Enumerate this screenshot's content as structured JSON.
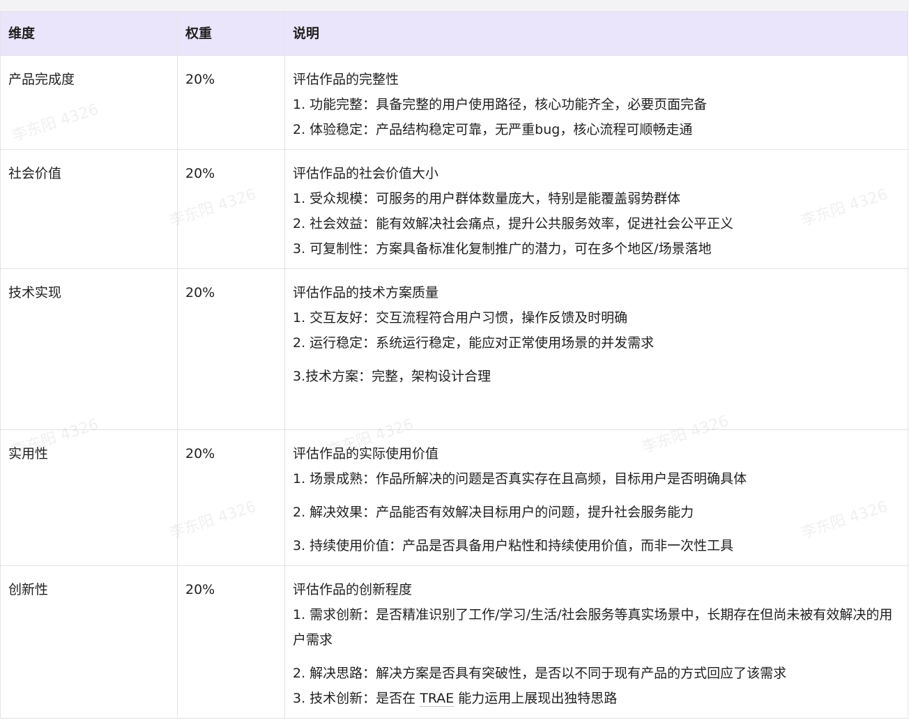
{
  "table": {
    "headers": [
      "维度",
      "权重",
      "说明"
    ],
    "rows": [
      {
        "dimension": "产品完成度",
        "weight": "20%",
        "lines": [
          "评估作品的完整性",
          "1. 功能完整：具备完整的用户使用路径，核心功能齐全，必要页面完备",
          "2. 体验稳定：产品结构稳定可靠，无严重bug，核心流程可顺畅走通"
        ]
      },
      {
        "dimension": "社会价值",
        "weight": "20%",
        "lines": [
          "评估作品的社会价值大小",
          "1. 受众规模：可服务的用户群体数量庞大，特别是能覆盖弱势群体",
          "2. 社会效益：能有效解决社会痛点，提升公共服务效率，促进社会公平正义",
          "3. 可复制性：方案具备标准化复制推广的潜力，可在多个地区/场景落地"
        ]
      },
      {
        "dimension": "技术实现",
        "weight": "20%",
        "lines": [
          "评估作品的技术方案质量",
          "1. 交互友好：交互流程符合用户习惯，操作反馈及时明确",
          "2. 运行稳定：系统运行稳定，能应对正常使用场景的并发需求",
          "3.技术方案：完整，架构设计合理"
        ]
      },
      {
        "dimension": "实用性",
        "weight": "20%",
        "lines": [
          "评估作品的实际使用价值",
          "1. 场景成熟：作品所解决的问题是否真实存在且高频，目标用户是否明确具体",
          "2. 解决效果：产品能否有效解决目标用户的问题，提升社会服务能力",
          "3. 持续使用价值：产品是否具备用户粘性和持续使用价值，而非一次性工具"
        ]
      },
      {
        "dimension": "创新性",
        "weight": "20%",
        "lines": [
          "评估作品的创新程度",
          "1. 需求创新：是否精准识别了工作/学习/生活/社会服务等真实场景中，长期存在但尚未被有效解决的用户需求",
          "2. 解决思路：解决方案是否具有突破性，是否以不同于现有产品的方式回应了该需求"
        ],
        "last_line": {
          "before": "3. 技术创新：是否在 ",
          "link": "TRAE",
          "after": " 能力运用上展现出独特思路"
        }
      }
    ]
  },
  "watermark": {
    "text": "李东阳 4326"
  }
}
